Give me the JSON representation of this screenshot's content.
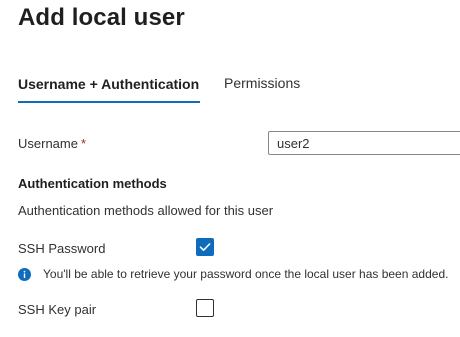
{
  "page": {
    "title": "Add local user"
  },
  "tabs": [
    {
      "label": "Username + Authentication",
      "selected": true
    },
    {
      "label": "Permissions",
      "selected": false
    }
  ],
  "form": {
    "username_label": "Username",
    "required_marker": "*",
    "username_value": "user2",
    "auth_heading": "Authentication methods",
    "auth_description": "Authentication methods allowed for this user",
    "ssh_password_label": "SSH Password",
    "ssh_password_checked": true,
    "info_message": "You'll be able to retrieve your password once the local user has been added.",
    "ssh_key_label": "SSH Key pair",
    "ssh_key_checked": false
  },
  "icons": {
    "checkmark": "checkmark-icon",
    "info": "info-icon"
  },
  "colors": {
    "accent": "#0f6cbd",
    "required": "#a4262c",
    "text": "#323130"
  }
}
